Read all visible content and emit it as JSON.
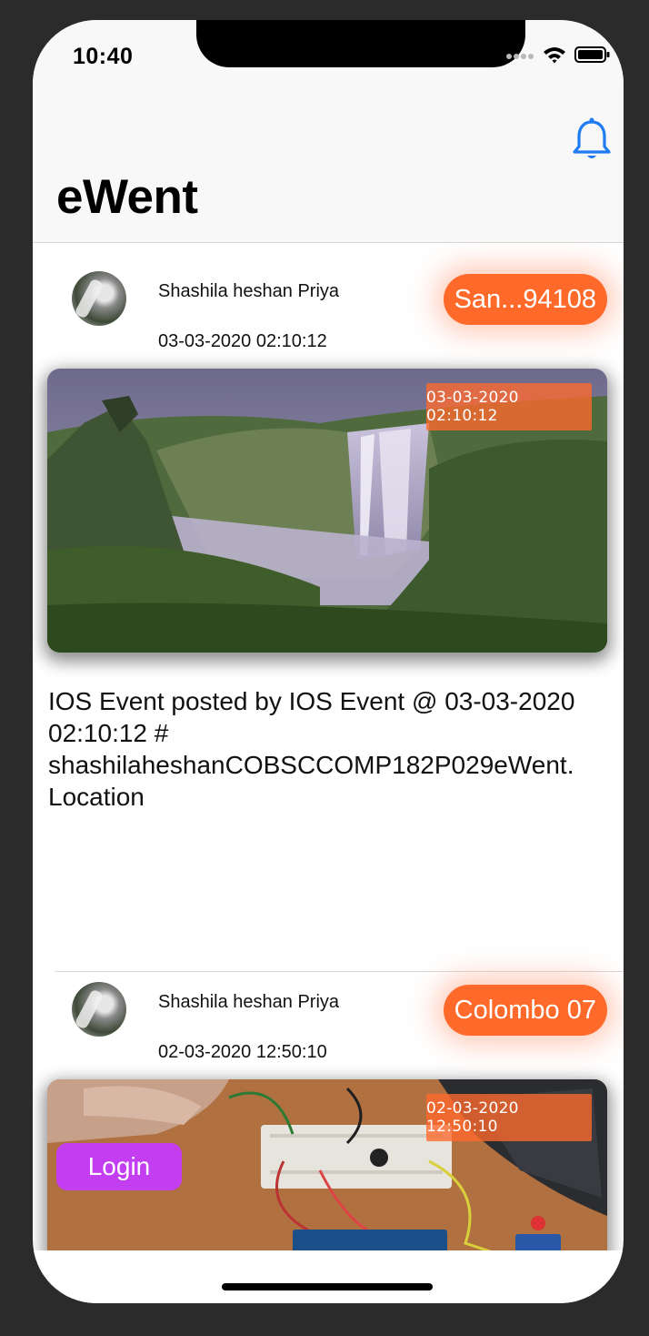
{
  "status_bar": {
    "time": "10:40"
  },
  "nav": {
    "title": "eWent"
  },
  "posts": [
    {
      "author": "Shashila heshan Priya",
      "time": "03-03-2020 02:10:12",
      "location": "San...94108",
      "photo_timestamp": "03-03-2020 02:10:12",
      "caption": "IOS Event posted by IOS Event @ 03-03-2020 02:10:12 # shashilaheshanCOBSCCOMP182P029eWent. Location"
    },
    {
      "author": "Shashila heshan Priya",
      "time": "02-03-2020 12:50:10",
      "location": "Colombo 07",
      "photo_timestamp": "02-03-2020 12:50:10"
    }
  ],
  "login": {
    "label": "Login"
  },
  "colors": {
    "accent_orange": "#ff6a2b",
    "login_purple": "#c33ef0",
    "bell_blue": "#1f7cf2"
  }
}
